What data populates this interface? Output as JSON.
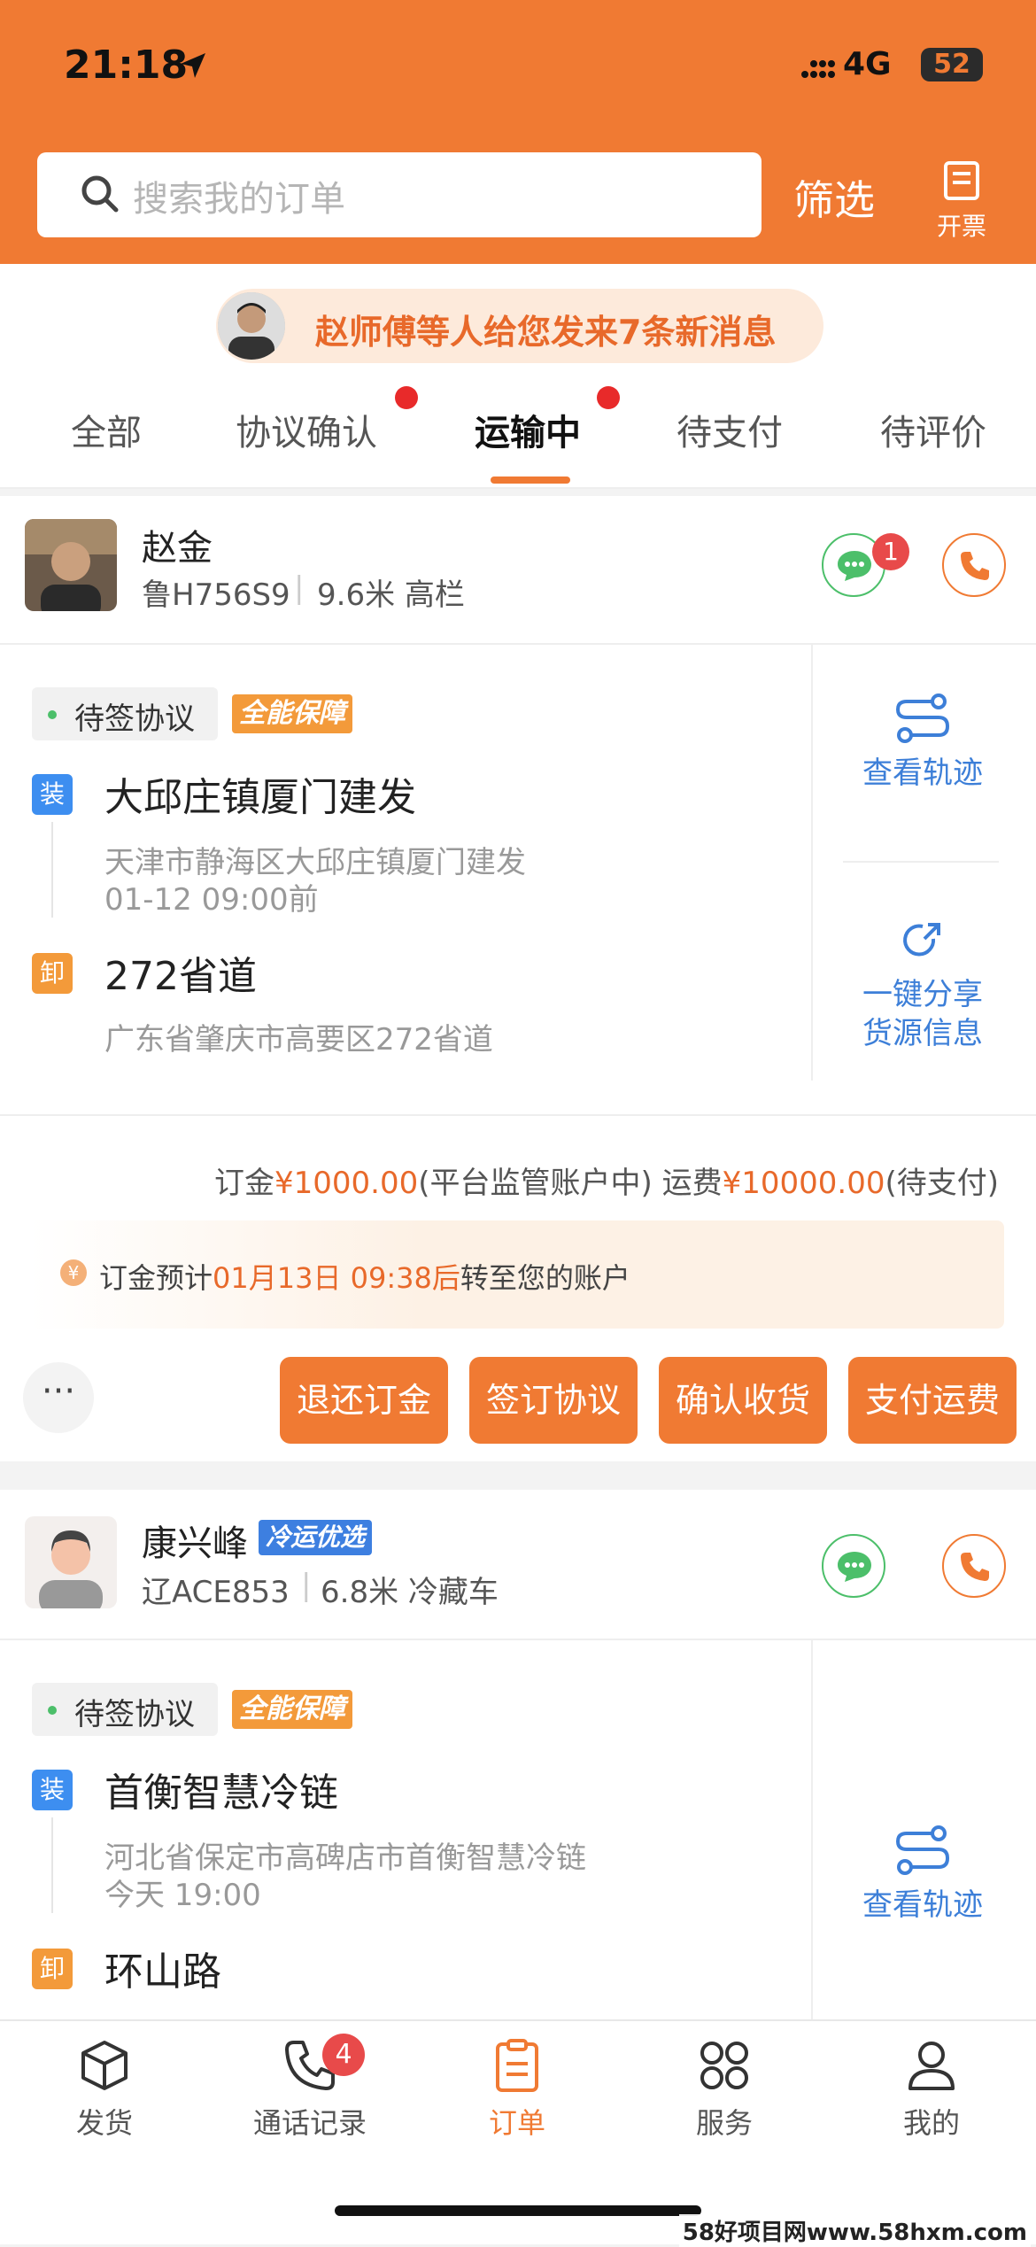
{
  "status_bar": {
    "time": "21:18",
    "network": "4G",
    "battery": "52"
  },
  "header": {
    "search_placeholder": "搜索我的订单",
    "filter_label": "筛选",
    "invoice_label": "开票"
  },
  "notice": {
    "text": "赵师傅等人给您发来7条新消息"
  },
  "tabs": [
    {
      "label": "全部",
      "dot": false
    },
    {
      "label": "协议确认",
      "dot": true
    },
    {
      "label": "运输中",
      "dot": true,
      "active": true
    },
    {
      "label": "待支付",
      "dot": false
    },
    {
      "label": "待评价",
      "dot": false
    }
  ],
  "orders": [
    {
      "driver_name": "赵金",
      "plate": "鲁H756S9",
      "vehicle": "9.6米 高栏",
      "message_count": "1",
      "status": "待签协议",
      "guarantee": "全能保障",
      "load_tag": "装",
      "load_title": "大邱庄镇厦门建发",
      "load_address": "天津市静海区大邱庄镇厦门建发",
      "load_time": "01-12 09:00前",
      "unload_tag": "卸",
      "unload_title": "272省道",
      "unload_address": "广东省肇庆市高要区272省道",
      "track_label": "查看轨迹",
      "share_label_1": "一键分享",
      "share_label_2": "货源信息",
      "fee_deposit_label": "订金",
      "fee_deposit_amount": "¥1000.00",
      "fee_deposit_note": "(平台监管账户中)",
      "fee_freight_label": "运费",
      "fee_freight_amount": "¥10000.00",
      "fee_freight_note": "(待支付)",
      "tip_prefix": "订金预计",
      "tip_time": "01月13日 09:38后",
      "tip_suffix": "转至您的账户",
      "tip_icon": "¥",
      "more": "···",
      "buttons": [
        "退还订金",
        "签订协议",
        "确认收货",
        "支付运费"
      ]
    },
    {
      "driver_name": "康兴峰",
      "cold_tag": "冷运优选",
      "plate": "辽ACE853",
      "vehicle": "6.8米 冷藏车",
      "status": "待签协议",
      "guarantee": "全能保障",
      "load_tag": "装",
      "load_title": "首衡智慧冷链",
      "load_address": "河北省保定市高碑店市首衡智慧冷链",
      "load_time": "今天 19:00",
      "unload_tag": "卸",
      "unload_title": "环山路",
      "track_label": "查看轨迹"
    }
  ],
  "bottom_nav": [
    {
      "label": "发货",
      "icon": "box-icon"
    },
    {
      "label": "通话记录",
      "icon": "phone-icon",
      "badge": "4"
    },
    {
      "label": "订单",
      "icon": "clipboard-icon",
      "active": true
    },
    {
      "label": "服务",
      "icon": "grid-icon"
    },
    {
      "label": "我的",
      "icon": "person-icon"
    }
  ],
  "watermark": "58好项目网www.58hxm.com",
  "colors": {
    "accent": "#f07a33",
    "link": "#3d7fd8",
    "chat": "#4cbf6a"
  }
}
